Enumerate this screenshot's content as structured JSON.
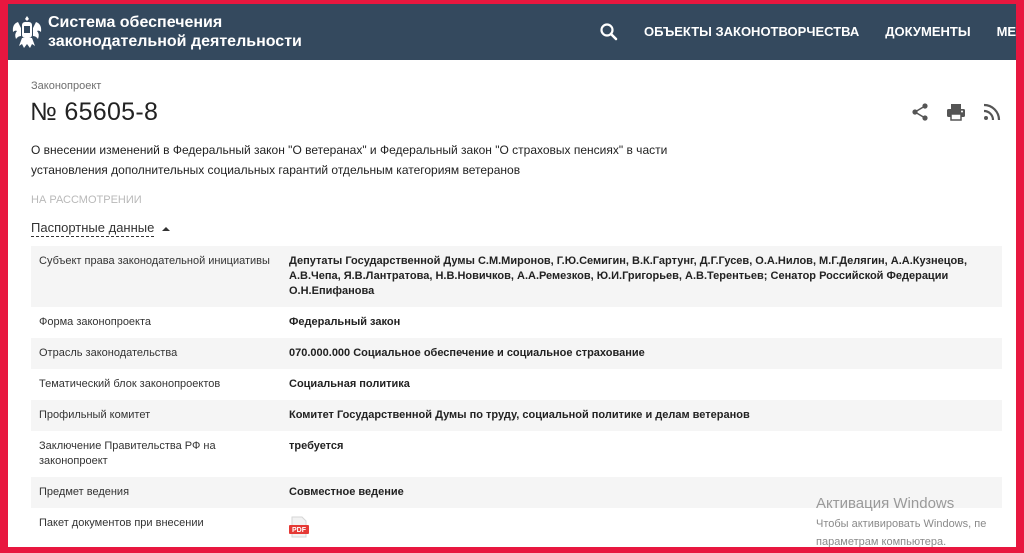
{
  "header": {
    "title_line1": "Система обеспечения",
    "title_line2": "законодательной деятельности",
    "nav": [
      "ОБЪЕКТЫ ЗАКОНОТВОРЧЕСТВА",
      "ДОКУМЕНТЫ",
      "МЕРО"
    ]
  },
  "bill": {
    "crumb": "Законопроект",
    "number": "№ 65605-8",
    "description": "О внесении изменений в Федеральный закон \"О ветеранах\" и Федеральный закон \"О страховых пенсиях\" в части установления дополнительных социальных гарантий отдельным категориям ветеранов",
    "status": "НА РАССМОТРЕНИИ"
  },
  "passport": {
    "toggle_label": "Паспортные данные",
    "rows": [
      {
        "key": "Субъект права законодательной инициативы",
        "value": "Депутаты Государственной Думы С.М.Миронов, Г.Ю.Семигин, В.К.Гартунг, Д.Г.Гусев, О.А.Нилов, М.Г.Делягин, А.А.Кузнецов, А.В.Чепа, Я.В.Лантратова, Н.В.Новичков, А.А.Ремезков, Ю.И.Григорьев, А.В.Терентьев; Сенатор Российской Федерации О.Н.Епифанова"
      },
      {
        "key": "Форма законопроекта",
        "value": "Федеральный закон"
      },
      {
        "key": "Отрасль законодательства",
        "value": "070.000.000 Социальное обеспечение и социальное страхование"
      },
      {
        "key": "Тематический блок законопроектов",
        "value": "Социальная политика"
      },
      {
        "key": "Профильный комитет",
        "value": "Комитет Государственной Думы по труду, социальной политике и делам ветеранов"
      },
      {
        "key": "Заключение Правительства РФ на законопроект",
        "value": "требуется"
      },
      {
        "key": "Предмет ведения",
        "value": "Совместное ведение"
      },
      {
        "key": "Пакет документов при внесении",
        "value": ""
      }
    ]
  },
  "pdf_label": "PDF",
  "watermark": {
    "line1": "Активация Windows",
    "line2": "Чтобы активировать Windows, пе",
    "line3": "параметрам компьютера."
  },
  "colors": {
    "header_bg": "#34495e",
    "border": "#e8173f",
    "pdf": "#e53935"
  }
}
